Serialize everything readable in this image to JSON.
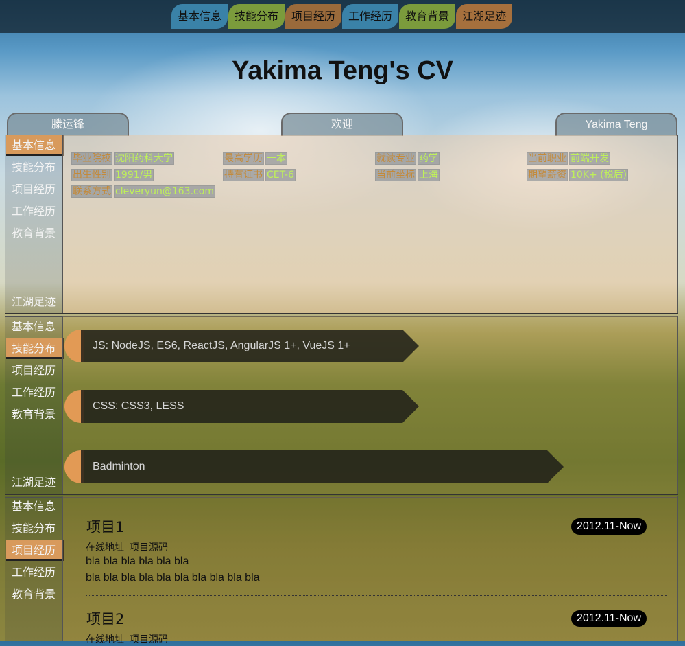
{
  "top_nav": [
    "基本信息",
    "技能分布",
    "项目经历",
    "工作经历",
    "教育背景",
    "江湖足迹"
  ],
  "title": "Yakima Teng's CV",
  "header_tabs": {
    "left": "滕运锋",
    "center": "欢迎",
    "right": "Yakima Teng"
  },
  "sidebar": {
    "items": [
      "基本信息",
      "技能分布",
      "项目经历",
      "工作经历",
      "教育背景"
    ],
    "footer": "江湖足迹"
  },
  "basic_info": {
    "rows": [
      [
        {
          "label": "毕业院校",
          "value": "沈阳药科大学"
        },
        {
          "label": "最高学历",
          "value": "一本"
        },
        {
          "label": "就读专业",
          "value": "药学"
        },
        {
          "label": "当前职业",
          "value": "前端开发"
        }
      ],
      [
        {
          "label": "出生性别",
          "value": "1991/男"
        },
        {
          "label": "持有证书",
          "value": "CET-6"
        },
        {
          "label": "当前坐标",
          "value": "上海"
        },
        {
          "label": "期望薪资",
          "value": "10K+ (税后)"
        }
      ],
      [
        {
          "label": "联系方式",
          "value": "cleveryun@163.com"
        }
      ]
    ]
  },
  "skills": [
    {
      "text": "JS: NodeJS, ES6, ReactJS, AngularJS 1+, VueJS 1+",
      "level": 0.56
    },
    {
      "text": "CSS: CSS3, LESS",
      "level": 0.56
    },
    {
      "text": "Badminton",
      "level": 0.8
    }
  ],
  "projects": [
    {
      "title": "项目1",
      "date": "2012.11-Now",
      "links": [
        "在线地址",
        "项目源码"
      ],
      "desc": [
        "bla bla bla bla bla bla",
        "bla bla bla bla bla bla bla bla bla bla"
      ]
    },
    {
      "title": "项目2",
      "date": "2012.11-Now",
      "links": [
        "在线地址",
        "项目源码"
      ],
      "desc": []
    }
  ],
  "colors": {
    "accent": "#d89a5c",
    "tab_blue": "#3a82a8",
    "tab_green": "#7b9b3c",
    "tab_brown": "#9a6a3b",
    "value_green": "#bff05a",
    "label_orange": "#c48a3a"
  }
}
